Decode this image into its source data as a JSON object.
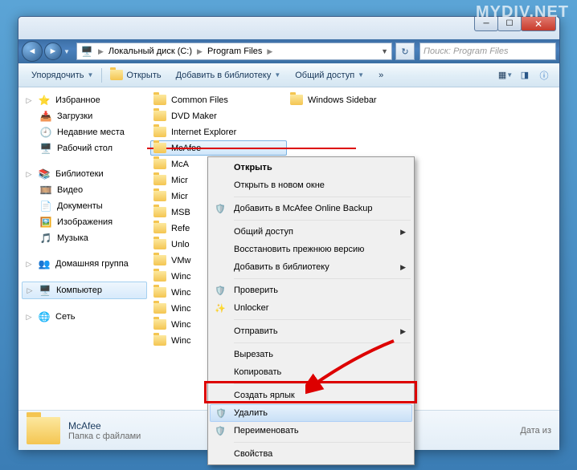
{
  "watermark": "MYDIV.NET",
  "breadcrumb": {
    "drive_icon": "💽",
    "drive": "Локальный диск (C:)",
    "folder": "Program Files"
  },
  "search": {
    "placeholder": "Поиск: Program Files"
  },
  "toolbar": {
    "organize": "Упорядочить",
    "open": "Открыть",
    "add_library": "Добавить в библиотеку",
    "share": "Общий доступ",
    "burn": "»"
  },
  "nav": {
    "favorites": {
      "label": "Избранное",
      "items": [
        "Загрузки",
        "Недавние места",
        "Рабочий стол"
      ]
    },
    "libraries": {
      "label": "Библиотеки",
      "items": [
        "Видео",
        "Документы",
        "Изображения",
        "Музыка"
      ]
    },
    "homegroup": "Домашняя группа",
    "computer": "Компьютер",
    "network": "Сеть"
  },
  "files": {
    "col1": [
      "Common Files",
      "DVD Maker",
      "Internet Explorer",
      "McAfee",
      "McA",
      "Micr",
      "Micr",
      "MSB",
      "Refe",
      "Unlo",
      "VMw",
      "Winc",
      "Winc",
      "Winc",
      "Winc",
      "Winc"
    ],
    "col2": [
      "Windows Sidebar"
    ]
  },
  "details": {
    "name": "McAfee",
    "type": "Папка с файлами",
    "date_label": "Дата из"
  },
  "ctx": {
    "open": "Открыть",
    "open_new": "Открыть в новом окне",
    "mcafee_backup": "Добавить в McAfee Online Backup",
    "share": "Общий доступ",
    "restore": "Восстановить прежнюю версию",
    "add_lib": "Добавить в библиотеку",
    "check": "Проверить",
    "unlocker": "Unlocker",
    "send": "Отправить",
    "cut": "Вырезать",
    "copy": "Копировать",
    "shortcut": "Создать ярлык",
    "delete": "Удалить",
    "rename": "Переименовать",
    "props": "Свойства"
  }
}
